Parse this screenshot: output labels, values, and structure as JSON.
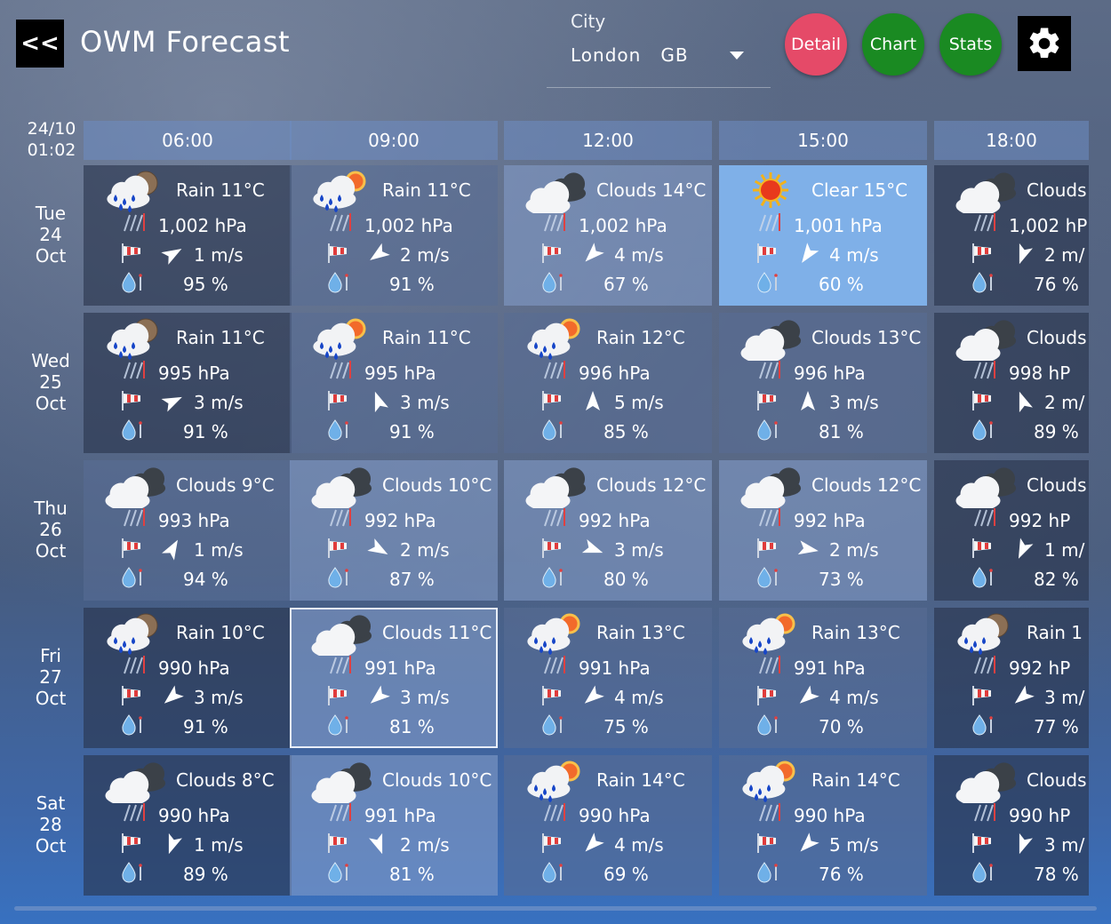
{
  "header": {
    "back_label": "<<",
    "title": "OWM Forecast",
    "city_label": "City",
    "city_value": "London   GB",
    "buttons": [
      {
        "label": "Detail",
        "color": "#e54a68"
      },
      {
        "label": "Chart",
        "color": "#1a8a22"
      },
      {
        "label": "Stats",
        "color": "#1a8a22"
      }
    ]
  },
  "colors": {
    "settings_bg": "#000000",
    "clear_cell": "#7fb0e8"
  },
  "timestamp": [
    "24/10",
    "01:02"
  ],
  "hours": [
    "06:00",
    "09:00",
    "12:00",
    "15:00",
    "18:00"
  ],
  "days": [
    {
      "lines": [
        "Tue",
        "24",
        "Oct"
      ],
      "cells": [
        {
          "summary": "Rain 11°C",
          "icon": "rain-night-icon",
          "pressure": "1,002 hPa",
          "wind": "1 m/s",
          "wind_deg": 60,
          "humidity": "95 %",
          "tone": "night"
        },
        {
          "summary": "Rain 11°C",
          "icon": "rain-sun-icon",
          "pressure": "1,002 hPa",
          "wind": "2 m/s",
          "wind_deg": 235,
          "humidity": "91 %",
          "tone": "mid"
        },
        {
          "summary": "Clouds 14°C",
          "icon": "clouds-icon",
          "pressure": "1,002 hPa",
          "wind": "4 m/s",
          "wind_deg": 225,
          "humidity": "67 %",
          "tone": "light"
        },
        {
          "summary": "Clear 15°C",
          "icon": "sun-icon",
          "pressure": "1,001 hPa",
          "wind": "4 m/s",
          "wind_deg": 215,
          "humidity": "60 %",
          "tone": "clear"
        },
        {
          "summary": "Clouds",
          "icon": "clouds-icon",
          "pressure": "1,002 hP",
          "wind": "2 m/",
          "wind_deg": 200,
          "humidity": "76 %",
          "tone": "night"
        }
      ]
    },
    {
      "lines": [
        "Wed",
        "25",
        "Oct"
      ],
      "cells": [
        {
          "summary": "Rain 11°C",
          "icon": "rain-night-icon",
          "pressure": "995 hPa",
          "wind": "3 m/s",
          "wind_deg": 65,
          "humidity": "91 %",
          "tone": "night"
        },
        {
          "summary": "Rain 11°C",
          "icon": "rain-sun-icon",
          "pressure": "995 hPa",
          "wind": "3 m/s",
          "wind_deg": 340,
          "humidity": "91 %",
          "tone": "mid"
        },
        {
          "summary": "Rain 12°C",
          "icon": "rain-sun-icon",
          "pressure": "996 hPa",
          "wind": "5 m/s",
          "wind_deg": 0,
          "humidity": "85 %",
          "tone": "mid"
        },
        {
          "summary": "Clouds 13°C",
          "icon": "clouds-icon",
          "pressure": "996 hPa",
          "wind": "3 m/s",
          "wind_deg": 0,
          "humidity": "81 %",
          "tone": "mid"
        },
        {
          "summary": "Clouds",
          "icon": "clouds-icon",
          "pressure": "998 hP",
          "wind": "2 m/",
          "wind_deg": 340,
          "humidity": "89 %",
          "tone": "night"
        }
      ]
    },
    {
      "lines": [
        "Thu",
        "26",
        "Oct"
      ],
      "cells": [
        {
          "summary": "Clouds 9°C",
          "icon": "clouds-icon",
          "pressure": "993 hPa",
          "wind": "1 m/s",
          "wind_deg": 30,
          "humidity": "94 %",
          "tone": "mid"
        },
        {
          "summary": "Clouds 10°C",
          "icon": "clouds-icon",
          "pressure": "992 hPa",
          "wind": "2 m/s",
          "wind_deg": 120,
          "humidity": "87 %",
          "tone": "light"
        },
        {
          "summary": "Clouds 12°C",
          "icon": "clouds-icon",
          "pressure": "992 hPa",
          "wind": "3 m/s",
          "wind_deg": 110,
          "humidity": "80 %",
          "tone": "light"
        },
        {
          "summary": "Clouds 12°C",
          "icon": "clouds-icon",
          "pressure": "992 hPa",
          "wind": "2 m/s",
          "wind_deg": 100,
          "humidity": "73 %",
          "tone": "light"
        },
        {
          "summary": "Clouds",
          "icon": "clouds-icon",
          "pressure": "992 hP",
          "wind": "1 m/",
          "wind_deg": 205,
          "humidity": "82 %",
          "tone": "night"
        }
      ]
    },
    {
      "lines": [
        "Fri",
        "27",
        "Oct"
      ],
      "cells": [
        {
          "summary": "Rain 10°C",
          "icon": "rain-night-icon",
          "pressure": "990 hPa",
          "wind": "3 m/s",
          "wind_deg": 230,
          "humidity": "91 %",
          "tone": "night"
        },
        {
          "summary": "Clouds 11°C",
          "icon": "clouds-icon",
          "pressure": "991 hPa",
          "wind": "3 m/s",
          "wind_deg": 230,
          "humidity": "81 %",
          "tone": "light",
          "selected": true
        },
        {
          "summary": "Rain 13°C",
          "icon": "rain-sun-icon",
          "pressure": "991 hPa",
          "wind": "4 m/s",
          "wind_deg": 230,
          "humidity": "75 %",
          "tone": "mid"
        },
        {
          "summary": "Rain 13°C",
          "icon": "rain-sun-icon",
          "pressure": "991 hPa",
          "wind": "4 m/s",
          "wind_deg": 230,
          "humidity": "70 %",
          "tone": "mid"
        },
        {
          "summary": "Rain 1",
          "icon": "rain-night-icon",
          "pressure": "992 hP",
          "wind": "3 m/",
          "wind_deg": 230,
          "humidity": "77 %",
          "tone": "night"
        }
      ]
    },
    {
      "lines": [
        "Sat",
        "28",
        "Oct"
      ],
      "cells": [
        {
          "summary": "Clouds 8°C",
          "icon": "clouds-icon",
          "pressure": "990 hPa",
          "wind": "1 m/s",
          "wind_deg": 200,
          "humidity": "89 %",
          "tone": "night"
        },
        {
          "summary": "Clouds 10°C",
          "icon": "clouds-icon",
          "pressure": "991 hPa",
          "wind": "2 m/s",
          "wind_deg": 160,
          "humidity": "81 %",
          "tone": "light"
        },
        {
          "summary": "Rain 14°C",
          "icon": "rain-sun-icon",
          "pressure": "990 hPa",
          "wind": "4 m/s",
          "wind_deg": 225,
          "humidity": "69 %",
          "tone": "mid"
        },
        {
          "summary": "Rain 14°C",
          "icon": "rain-sun-icon",
          "pressure": "990 hPa",
          "wind": "5 m/s",
          "wind_deg": 225,
          "humidity": "76 %",
          "tone": "mid"
        },
        {
          "summary": "Clouds",
          "icon": "clouds-icon",
          "pressure": "990 hP",
          "wind": "3 m/",
          "wind_deg": 200,
          "humidity": "78 %",
          "tone": "night"
        }
      ]
    }
  ]
}
